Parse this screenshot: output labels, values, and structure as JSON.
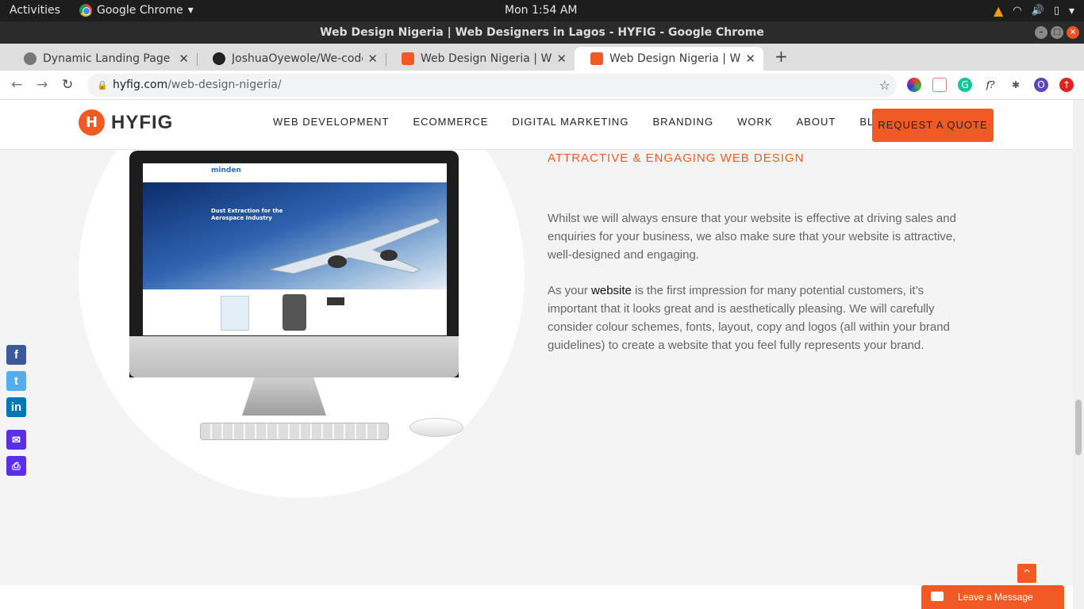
{
  "os_bar": {
    "activities": "Activities",
    "app_name": "Google Chrome",
    "clock": "Mon  1:54 AM"
  },
  "window": {
    "title": "Web Design Nigeria | Web Designers in Lagos - HYFIG - Google Chrome"
  },
  "tabs": [
    {
      "title": "Dynamic Landing Page",
      "favicon": "globe-icon"
    },
    {
      "title": "JoshuaOyewole/We-code",
      "favicon": "github-icon"
    },
    {
      "title": "Web Design Nigeria | Web",
      "favicon": "hyfig-icon"
    },
    {
      "title": "Web Design Nigeria | Web",
      "favicon": "hyfig-icon"
    }
  ],
  "address": {
    "host": "hyfig.com",
    "path": "/web-design-nigeria/"
  },
  "site": {
    "logo": "HYFIG",
    "menu": [
      "WEB DEVELOPMENT",
      "ECOMMERCE",
      "DIGITAL MARKETING",
      "BRANDING",
      "WORK",
      "ABOUT",
      "BLOG"
    ],
    "cta": "REQUEST A QUOTE"
  },
  "mockup": {
    "brand": "minden",
    "headline": "Dust Extraction for the Aerospace Industry"
  },
  "section": {
    "heading": "ATTRACTIVE & ENGAGING WEB DESIGN",
    "p1": "Whilst we will always ensure that your website is effective at driving sales and enquiries for your business, we also make sure that your website is attractive, well-designed and engaging.",
    "p2_before": "As your ",
    "p2_link": "website",
    "p2_after": " is the first impression for many potential customers, it’s important that it looks great and is aesthetically pleasing. We will carefully consider colour schemes, fonts, layout, copy and logos (all within your brand guidelines) to create a website that you feel fully represents your brand."
  },
  "chat": {
    "label": "Leave a Message"
  },
  "colors": {
    "brand": "#f15a22",
    "facebook": "#3b5998",
    "twitter": "#55acee",
    "linkedin": "#0077b5",
    "email": "#5b2ee8",
    "print": "#5b2ee8"
  }
}
